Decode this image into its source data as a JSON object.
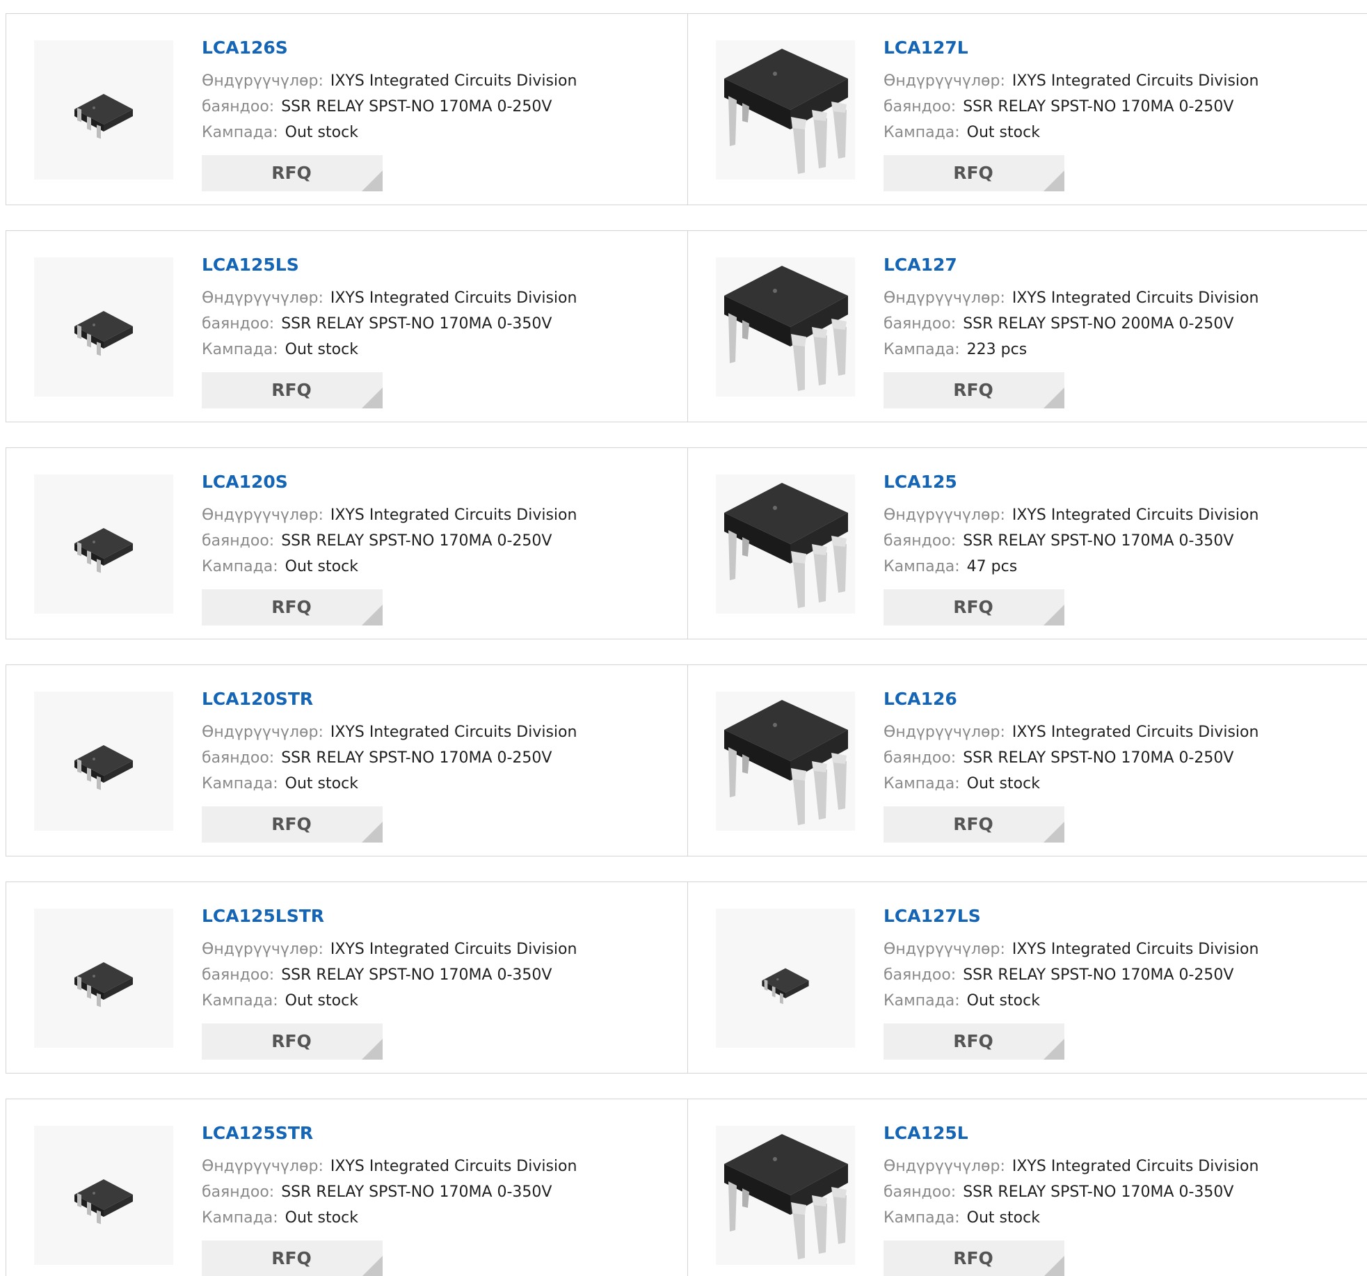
{
  "labels": {
    "manufacturer": "Өндүрүүчүлөр:",
    "description": "баяндоо:",
    "stock": "Кампада:",
    "rfq": "RFQ"
  },
  "products": [
    {
      "part": "LCA126S",
      "manufacturer": "IXYS Integrated Circuits Division",
      "description": "SSR RELAY SPST-NO 170MA 0-250V",
      "stock": "Out stock",
      "package": "smd-small-icon"
    },
    {
      "part": "LCA127L",
      "manufacturer": "IXYS Integrated Circuits Division",
      "description": "SSR RELAY SPST-NO 170MA 0-250V",
      "stock": "Out stock",
      "package": "dip-large-icon"
    },
    {
      "part": "LCA125LS",
      "manufacturer": "IXYS Integrated Circuits Division",
      "description": "SSR RELAY SPST-NO 170MA 0-350V",
      "stock": "Out stock",
      "package": "smd-small-icon"
    },
    {
      "part": "LCA127",
      "manufacturer": "IXYS Integrated Circuits Division",
      "description": "SSR RELAY SPST-NO 200MA 0-250V",
      "stock": "223 pcs",
      "package": "dip-large-icon"
    },
    {
      "part": "LCA120S",
      "manufacturer": "IXYS Integrated Circuits Division",
      "description": "SSR RELAY SPST-NO 170MA 0-250V",
      "stock": "Out stock",
      "package": "smd-small-icon"
    },
    {
      "part": "LCA125",
      "manufacturer": "IXYS Integrated Circuits Division",
      "description": "SSR RELAY SPST-NO 170MA 0-350V",
      "stock": "47 pcs",
      "package": "dip-large-icon"
    },
    {
      "part": "LCA120STR",
      "manufacturer": "IXYS Integrated Circuits Division",
      "description": "SSR RELAY SPST-NO 170MA 0-250V",
      "stock": "Out stock",
      "package": "smd-small-icon"
    },
    {
      "part": "LCA126",
      "manufacturer": "IXYS Integrated Circuits Division",
      "description": "SSR RELAY SPST-NO 170MA 0-250V",
      "stock": "Out stock",
      "package": "dip-large-icon"
    },
    {
      "part": "LCA125LSTR",
      "manufacturer": "IXYS Integrated Circuits Division",
      "description": "SSR RELAY SPST-NO 170MA 0-350V",
      "stock": "Out stock",
      "package": "smd-small-icon"
    },
    {
      "part": "LCA127LS",
      "manufacturer": "IXYS Integrated Circuits Division",
      "description": "SSR RELAY SPST-NO 170MA 0-250V",
      "stock": "Out stock",
      "package": "smd-small-icon"
    },
    {
      "part": "LCA125STR",
      "manufacturer": "IXYS Integrated Circuits Division",
      "description": "SSR RELAY SPST-NO 170MA 0-350V",
      "stock": "Out stock",
      "package": "smd-small-icon"
    },
    {
      "part": "LCA125L",
      "manufacturer": "IXYS Integrated Circuits Division",
      "description": "SSR RELAY SPST-NO 170MA 0-350V",
      "stock": "Out stock",
      "package": "dip-large-icon"
    }
  ],
  "colors": {
    "link": "#1565b6",
    "border": "#d4d4d4",
    "label": "#8a8a8a",
    "button_bg": "#efefef"
  }
}
